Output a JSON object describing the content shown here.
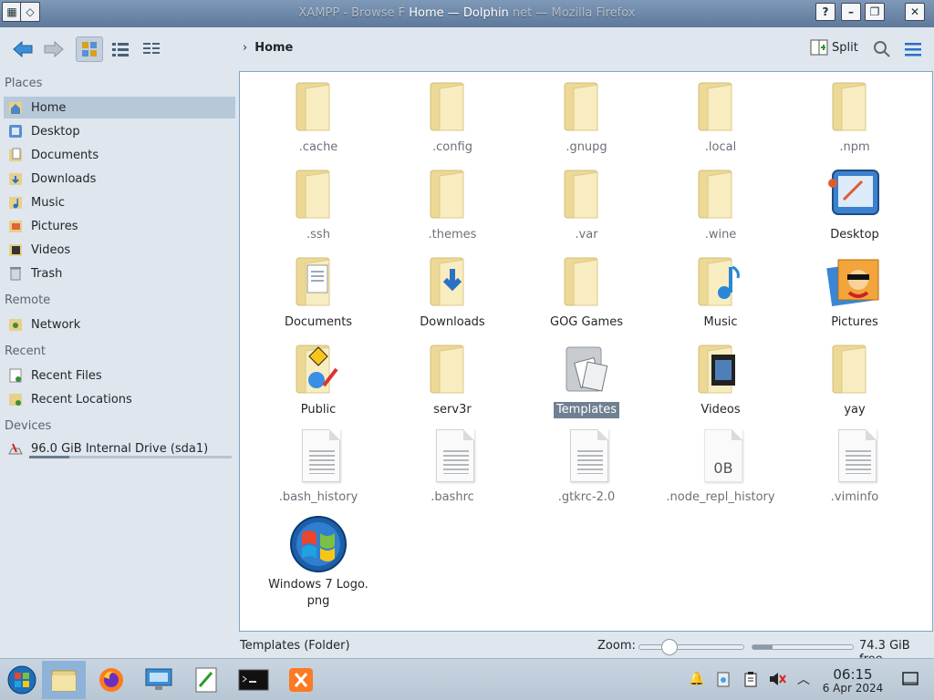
{
  "window": {
    "title_prefix": "XAMPP - Browse F",
    "title_main": "Home — Dolphin",
    "title_suffix": "net — Mozilla Firefox"
  },
  "toolbar": {
    "breadcrumb": "Home",
    "split_label": "Split"
  },
  "sidebar": {
    "places_title": "Places",
    "places": [
      "Home",
      "Desktop",
      "Documents",
      "Downloads",
      "Music",
      "Pictures",
      "Videos",
      "Trash"
    ],
    "remote_title": "Remote",
    "remote": [
      "Network"
    ],
    "recent_title": "Recent",
    "recent": [
      "Recent Files",
      "Recent Locations"
    ],
    "devices_title": "Devices",
    "devices": [
      "96.0 GiB Internal Drive (sda1)"
    ],
    "drive_usage_fraction": 0.2
  },
  "files": [
    {
      "name": ".cache",
      "kind": "folder"
    },
    {
      "name": ".config",
      "kind": "folder"
    },
    {
      "name": ".gnupg",
      "kind": "folder"
    },
    {
      "name": ".local",
      "kind": "folder"
    },
    {
      "name": ".npm",
      "kind": "folder"
    },
    {
      "name": ".ssh",
      "kind": "folder"
    },
    {
      "name": ".themes",
      "kind": "folder"
    },
    {
      "name": ".var",
      "kind": "folder"
    },
    {
      "name": ".wine",
      "kind": "folder"
    },
    {
      "name": "Desktop",
      "kind": "desktop"
    },
    {
      "name": "Documents",
      "kind": "folder-documents"
    },
    {
      "name": "Downloads",
      "kind": "folder-downloads"
    },
    {
      "name": "GOG Games",
      "kind": "folder"
    },
    {
      "name": "Music",
      "kind": "folder-music"
    },
    {
      "name": "Pictures",
      "kind": "pictures"
    },
    {
      "name": "Public",
      "kind": "folder-public"
    },
    {
      "name": "serv3r",
      "kind": "folder"
    },
    {
      "name": "Templates",
      "kind": "folder-templates"
    },
    {
      "name": "Videos",
      "kind": "folder-videos"
    },
    {
      "name": "yay",
      "kind": "folder"
    },
    {
      "name": ".bash_history",
      "kind": "text"
    },
    {
      "name": ".bashrc",
      "kind": "text"
    },
    {
      "name": ".gtkrc-2.0",
      "kind": "text"
    },
    {
      "name": ".node_repl_history",
      "kind": "empty",
      "badge": "0B"
    },
    {
      "name": ".viminfo",
      "kind": "text"
    },
    {
      "name": "Windows 7 Logo.png",
      "kind": "image",
      "line1": "Windows 7 Logo.",
      "line2": "png"
    }
  ],
  "selected_file": "Templates",
  "status": {
    "selection": "Templates (Folder)",
    "zoom_label": "Zoom:",
    "zoom_fraction": 0.25,
    "free_space": "74.3 GiB free",
    "disk_used_fraction": 0.2
  },
  "taskbar": {
    "time": "06:15",
    "date": "6 Apr 2024"
  },
  "colors": {
    "accent": "#6f8191",
    "selection_sidebar": "#b7c9d9",
    "view_border": "#7fa6c9"
  }
}
